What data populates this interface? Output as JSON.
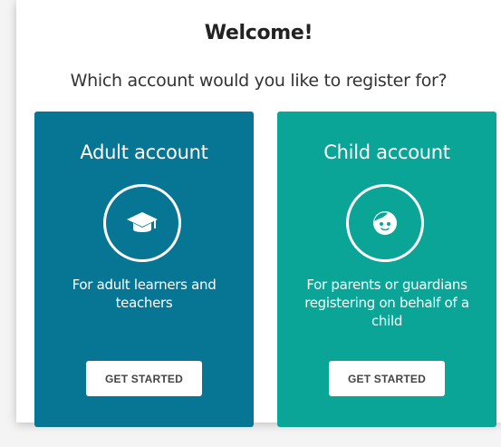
{
  "dialog": {
    "title": "Welcome!",
    "subtitle": "Which account would you like to register for?"
  },
  "cards": {
    "adult": {
      "title": "Adult account",
      "icon": "graduation-cap-icon",
      "description": "For adult learners and teachers",
      "button_label": "GET STARTED",
      "color": "#077594"
    },
    "child": {
      "title": "Child account",
      "icon": "child-face-icon",
      "description": "For parents or guardians registering on behalf of a child",
      "button_label": "GET STARTED",
      "color": "#0aa597"
    }
  }
}
